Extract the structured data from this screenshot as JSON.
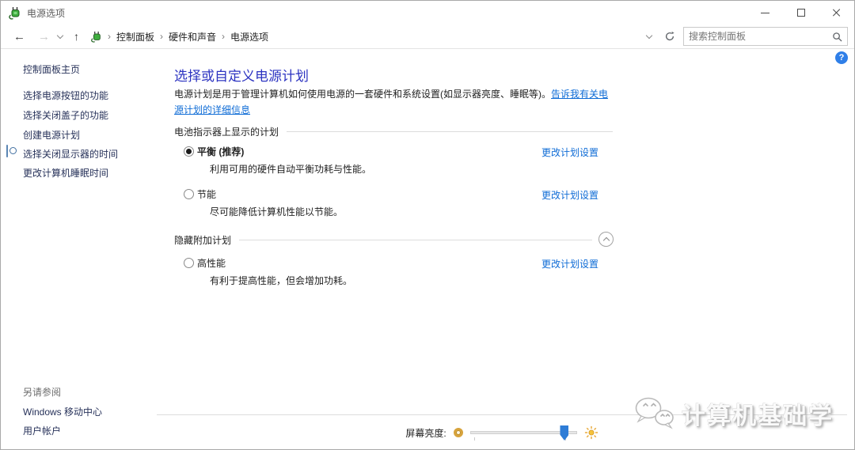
{
  "window": {
    "title": "电源选项"
  },
  "nav": {
    "separator": "›",
    "breadcrumb": [
      "控制面板",
      "硬件和声音",
      "电源选项"
    ],
    "search_placeholder": "搜索控制面板"
  },
  "sidebar": {
    "home": "控制面板主页",
    "tasks": [
      "选择电源按钮的功能",
      "选择关闭盖子的功能",
      "创建电源计划",
      "选择关闭显示器的时间",
      "更改计算机睡眠时间"
    ],
    "see_also": {
      "header": "另请参阅",
      "items": [
        "Windows 移动中心",
        "用户帐户"
      ]
    }
  },
  "main": {
    "title": "选择或自定义电源计划",
    "description": "电源计划是用于管理计算机如何使用电源的一套硬件和系统设置(如显示器亮度、睡眠等)。",
    "learn_more_link": "告诉我有关电源计划的详细信息",
    "help_label": "?",
    "sections": [
      {
        "header": "电池指示器上显示的计划",
        "plans": [
          {
            "name": "平衡 (推荐)",
            "desc": "利用可用的硬件自动平衡功耗与性能。",
            "selected": true,
            "bold": true,
            "link": "更改计划设置"
          },
          {
            "name": "节能",
            "desc": "尽可能降低计算机性能以节能。",
            "selected": false,
            "bold": false,
            "link": "更改计划设置"
          }
        ]
      },
      {
        "header": "隐藏附加计划",
        "collapsible": true,
        "plans": [
          {
            "name": "高性能",
            "desc": "有利于提高性能，但会增加功耗。",
            "selected": false,
            "bold": false,
            "link": "更改计划设置"
          }
        ]
      }
    ]
  },
  "bottom": {
    "brightness_label": "屏幕亮度:",
    "brightness_percent": 88
  },
  "watermark": {
    "text": "计算机基础学"
  },
  "colors": {
    "heading_blue": "#2d34c1",
    "link_blue": "#0f6cd6",
    "sidebar_link": "#27325a",
    "slider_thumb": "#2e7cd6",
    "help_badge": "#2f7fe8",
    "plug_green": "#3fae3f"
  }
}
